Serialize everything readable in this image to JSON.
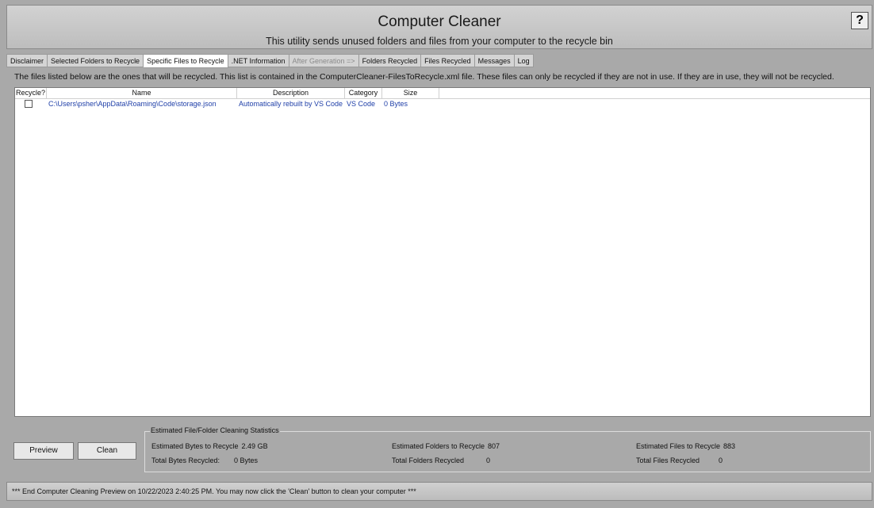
{
  "header": {
    "title": "Computer Cleaner",
    "subtitle": "This utility sends unused folders and files from your computer to the recycle bin",
    "help_label": "?"
  },
  "tabs": [
    {
      "label": "Disclaimer"
    },
    {
      "label": "Selected Folders to Recycle"
    },
    {
      "label": "Specific Files to Recycle",
      "active": true
    },
    {
      "label": ".NET Information"
    },
    {
      "label": "After Generation =>",
      "disabled": true
    },
    {
      "label": "Folders Recycled"
    },
    {
      "label": "Files Recycled"
    },
    {
      "label": "Messages"
    },
    {
      "label": "Log"
    }
  ],
  "info_text": "The files listed below are the ones that will be recycled. This list is contained in the ComputerCleaner-FilesToRecycle.xml file. These files can only be recycled if they are not in use. If they are in use, they will not be recycled.",
  "grid": {
    "columns": [
      "Recycle?",
      "Name",
      "Description",
      "Category",
      "Size"
    ],
    "rows": [
      {
        "recycle": false,
        "name": "C:\\Users\\psher\\AppData\\Roaming\\Code\\storage.json",
        "description": "Automatically rebuilt by VS Code",
        "category": "VS Code",
        "size": "0 Bytes"
      }
    ]
  },
  "buttons": {
    "preview": "Preview",
    "clean": "Clean"
  },
  "stats": {
    "legend": "Estimated File/Folder Cleaning Statistics",
    "est_bytes_label": "Estimated Bytes to Recycle",
    "est_bytes_value": "2.49 GB",
    "total_bytes_label": "Total Bytes Recycled:",
    "total_bytes_value": "0 Bytes",
    "est_folders_label": "Estimated Folders to Recycle",
    "est_folders_value": "807",
    "total_folders_label": "Total Folders Recycled",
    "total_folders_value": "0",
    "est_files_label": "Estimated Files to Recycle",
    "est_files_value": "883",
    "total_files_label": "Total Files Recycled",
    "total_files_value": "0"
  },
  "status_text": "*** End Computer Cleaning Preview on 10/22/2023 2:40:25 PM. You may now click the 'Clean' button to clean your computer ***"
}
